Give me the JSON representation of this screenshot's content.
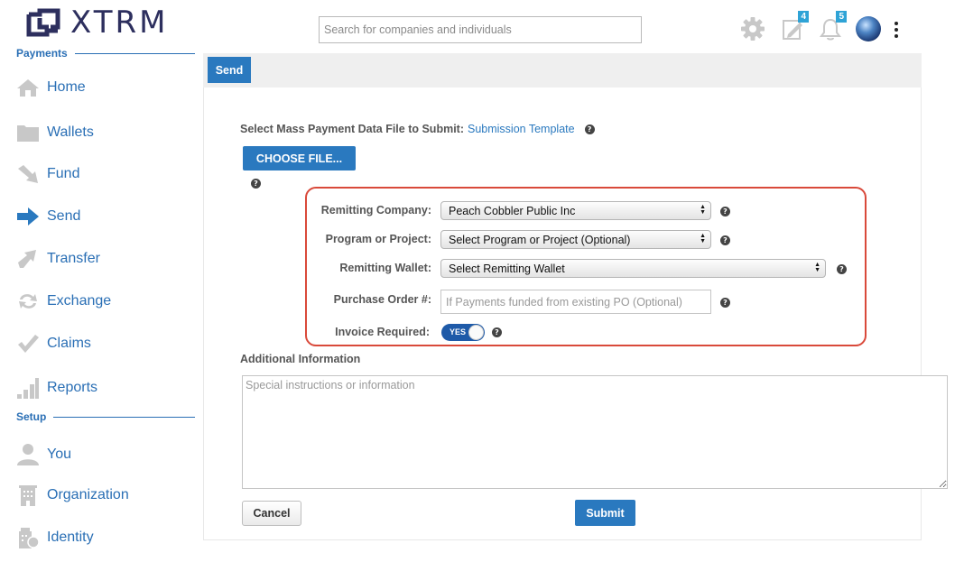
{
  "header": {
    "logo_text": "XTRM",
    "search": {
      "placeholder": "Search for companies and individuals",
      "value": ""
    },
    "icons": {
      "settings": "gear-icon",
      "edit": "edit-note-icon",
      "notifications": "bell-icon",
      "avatar": "avatar-globe",
      "menu": "kebab-menu-icon"
    },
    "edit_badge": "4",
    "notification_badge": "5"
  },
  "sidebar": {
    "payments_label": "Payments",
    "setup_label": "Setup",
    "payments_items": [
      {
        "label": "Home",
        "icon": "home-icon"
      },
      {
        "label": "Wallets",
        "icon": "folder-icon"
      },
      {
        "label": "Fund",
        "icon": "fund-arrow-icon"
      },
      {
        "label": "Send",
        "icon": "send-arrow-icon"
      },
      {
        "label": "Transfer",
        "icon": "transfer-arrow-icon"
      },
      {
        "label": "Exchange",
        "icon": "exchange-icon"
      },
      {
        "label": "Claims",
        "icon": "checkmark-icon"
      },
      {
        "label": "Reports",
        "icon": "bar-chart-icon"
      }
    ],
    "setup_items": [
      {
        "label": "You",
        "icon": "person-icon"
      },
      {
        "label": "Organization",
        "icon": "building-icon"
      },
      {
        "label": "Identity",
        "icon": "identity-icon"
      }
    ]
  },
  "main": {
    "tab_label": "Send",
    "select_file_label": "Select Mass Payment Data File to Submit:",
    "submission_template_link": "Submission Template",
    "choose_file_label": "CHOOSE FILE...",
    "form": {
      "remitting_company": {
        "label": "Remitting Company:",
        "value": "Peach Cobbler Public Inc"
      },
      "program_project": {
        "label": "Program or Project:",
        "value": "Select Program or Project (Optional)"
      },
      "remitting_wallet": {
        "label": "Remitting Wallet:",
        "value": "Select Remitting Wallet"
      },
      "purchase_order": {
        "label": "Purchase Order #:",
        "placeholder": "If Payments funded from existing PO (Optional)",
        "value": ""
      },
      "invoice_required": {
        "label": "Invoice Required:",
        "toggle_text": "YES",
        "on": true
      }
    },
    "additional_info_label": "Additional Information",
    "additional_info_placeholder": "Special instructions or information",
    "cancel_label": "Cancel",
    "submit_label": "Submit",
    "highlight_color": "#d9493a",
    "accent_color": "#2a79bf"
  }
}
